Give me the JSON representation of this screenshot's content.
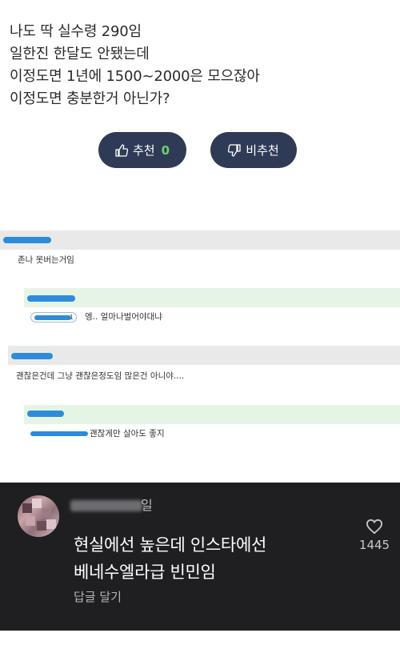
{
  "post": {
    "lines": [
      "나도 딱 실수령 290임",
      "일한진 한달도 안됐는데",
      "이정도면 1년에 1500~2000은 모으잖아",
      "이정도면 충분한거 아닌가?"
    ]
  },
  "votes": {
    "up_label": "추천",
    "up_count": "0",
    "down_label": "비추천"
  },
  "comments": [
    {
      "text": "존나 못버는거임"
    },
    {
      "mention_num": "1",
      "text": "엥.. 얼마나벌어야대냐"
    },
    {
      "text": "괜찮은건데 그냥 괜찮은정도임 많은건 아니야...."
    },
    {
      "text": "괜찮게만 살아도 좋지"
    }
  ],
  "dark_comment": {
    "user_suffix": "일",
    "lines": [
      "현실에선 높은데 인스타에선",
      "베네수엘라급 빈민임"
    ],
    "reply_label": "답글 달기",
    "like_count": "1445"
  },
  "colors": {
    "vote_button": "#2f3b56",
    "vote_count": "#6cd36c",
    "redaction": "#2d8bdc",
    "dark_card": "#1f1f22"
  }
}
